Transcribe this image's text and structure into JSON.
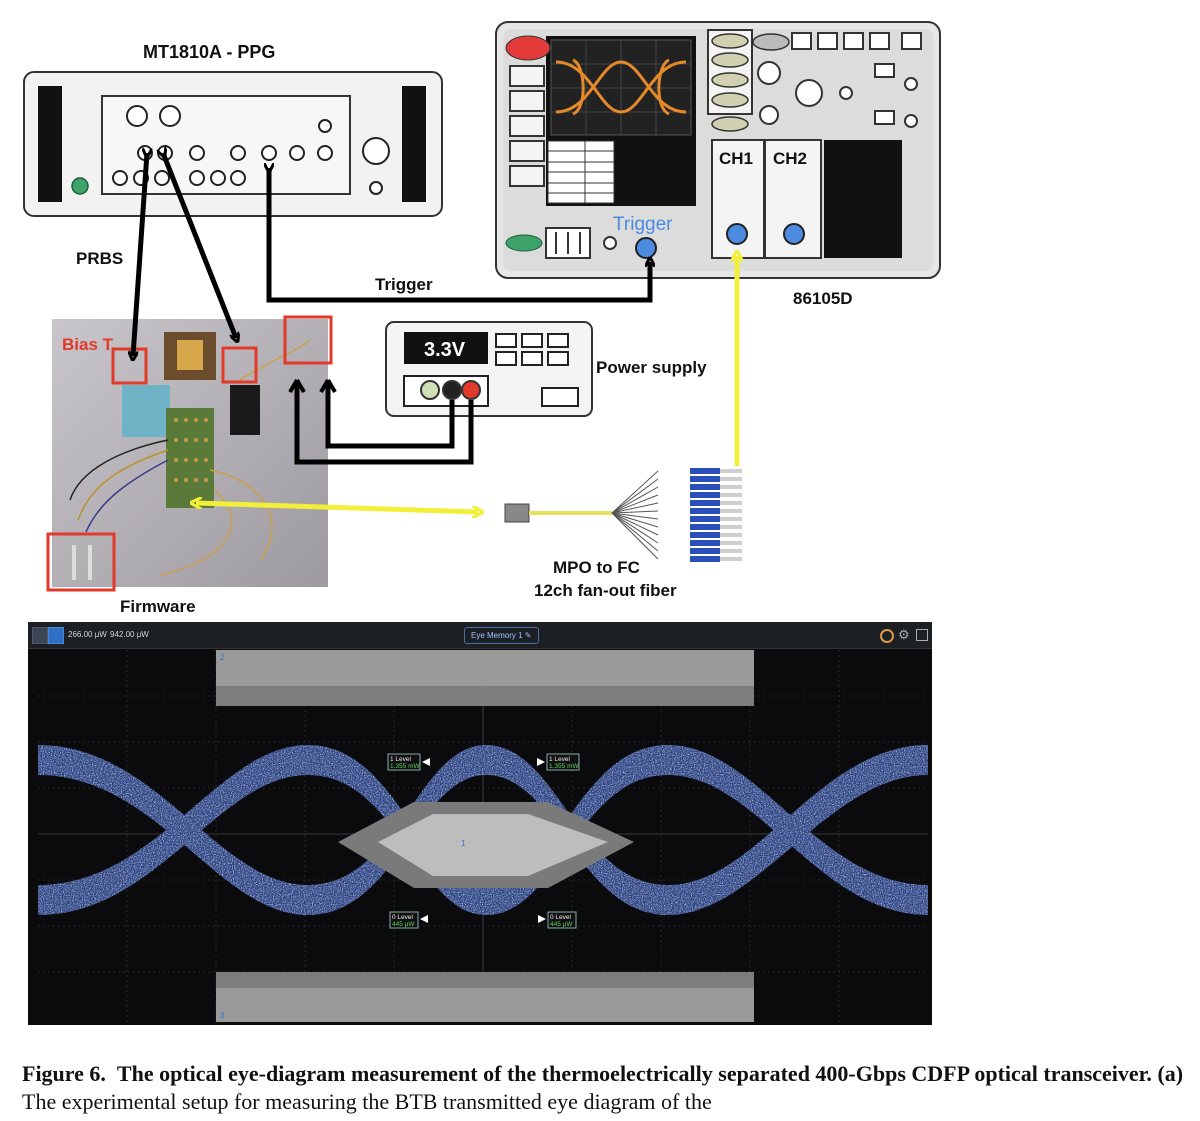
{
  "diagram": {
    "ppg_label": "MT1810A - PPG",
    "scope_label": "86105D",
    "trigger_label": "Trigger",
    "prbs_label": "PRBS",
    "bias_label": "Bias T",
    "firmware_label": "Firmware",
    "power_supply_label": "Power supply",
    "voltage": "3.3V",
    "ch1_label": "CH1",
    "ch2_label": "CH2",
    "scope_trigger_label": "Trigger",
    "fiber_label_line1": "MPO  to  FC",
    "fiber_label_line2": "12ch fan-out fiber"
  },
  "eye": {
    "power_low": "266.00 μW",
    "power_high": "942.00 μW",
    "memory_tab": "Eye Memory 1",
    "mask_top": "2",
    "mask_center": "1",
    "mask_bottom": "3",
    "level1_title": "1 Level",
    "level1_value": "1.355 mW",
    "level0_title": "0 Level",
    "level0_value": "445 μW",
    "colors": {
      "trace": "#6f8fe0",
      "mask": "#8a8a8a",
      "background": "#0b0b0d"
    }
  },
  "caption": {
    "fig": "Figure 6.",
    "title": "The optical eye-diagram measurement of the thermoelectrically separated 400-Gbps CDFP optical transceiver.",
    "part": "(a)",
    "body": "The experimental setup for measuring the BTB transmitted eye diagram of the"
  }
}
